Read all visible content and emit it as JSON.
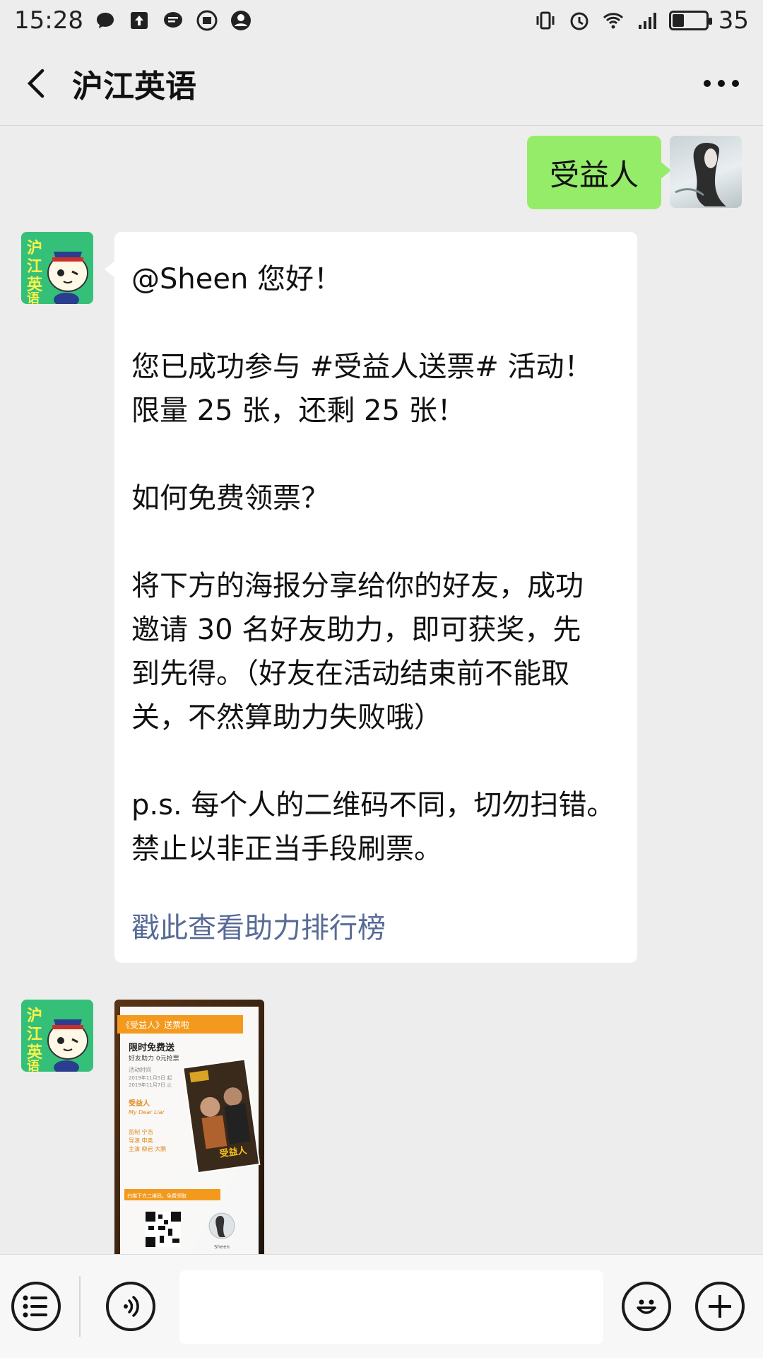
{
  "status_bar": {
    "time": "15:28",
    "battery": "35",
    "battery_level": 0.35,
    "network": "4G",
    "icons_left": [
      "chat-bubble-icon",
      "upload-icon",
      "message-icon",
      "app-icon",
      "person-icon"
    ],
    "icons_right": [
      "vibrate-icon",
      "alarm-icon",
      "wifi-icon",
      "signal-icon",
      "battery-icon"
    ]
  },
  "header": {
    "title": "沪江英语",
    "back_icon": "chevron-left-icon",
    "more_icon": "more-icon"
  },
  "messages": {
    "sent": {
      "text": "受益人"
    },
    "received": {
      "lines": [
        "@Sheen 您好！",
        "您已成功参与 #受益人送票# 活动！\n限量 25 张，还剩 25 张！",
        "如何免费领票？",
        "将下方的海报分享给你的好友，成功\n邀请 30 名好友助力，即可获奖，先\n到先得。（好友在活动结束前不能取\n关，不然算助力失败哦）",
        "p.s. 每个人的二维码不同，切勿扫错。\n禁止以非正当手段刷票。"
      ],
      "link": "戳此查看助力排行榜"
    },
    "avatar_text": "沪江英语",
    "poster": {
      "banner": "《受益人》送票啦",
      "headline": "限时免费送",
      "sub": "好友助力 0元抢票",
      "time_label": "活动时间",
      "time_1": "2019年11月5日 起",
      "time_2": "2019年11月7日 止",
      "movie_cn": "受益人",
      "movie_en": "My Dear Liar",
      "credits": [
        "监制 宁浩",
        "导演 申奥",
        "主演 柳岩 大鹏"
      ],
      "poster_title": "受益人",
      "scan_text": "扫描下方二维码，免费领取",
      "user_name": "Sheen"
    }
  },
  "input_bar": {
    "menu_icon": "list-menu-icon",
    "voice_icon": "voice-icon",
    "emoji_icon": "emoji-icon",
    "plus_icon": "plus-icon"
  }
}
